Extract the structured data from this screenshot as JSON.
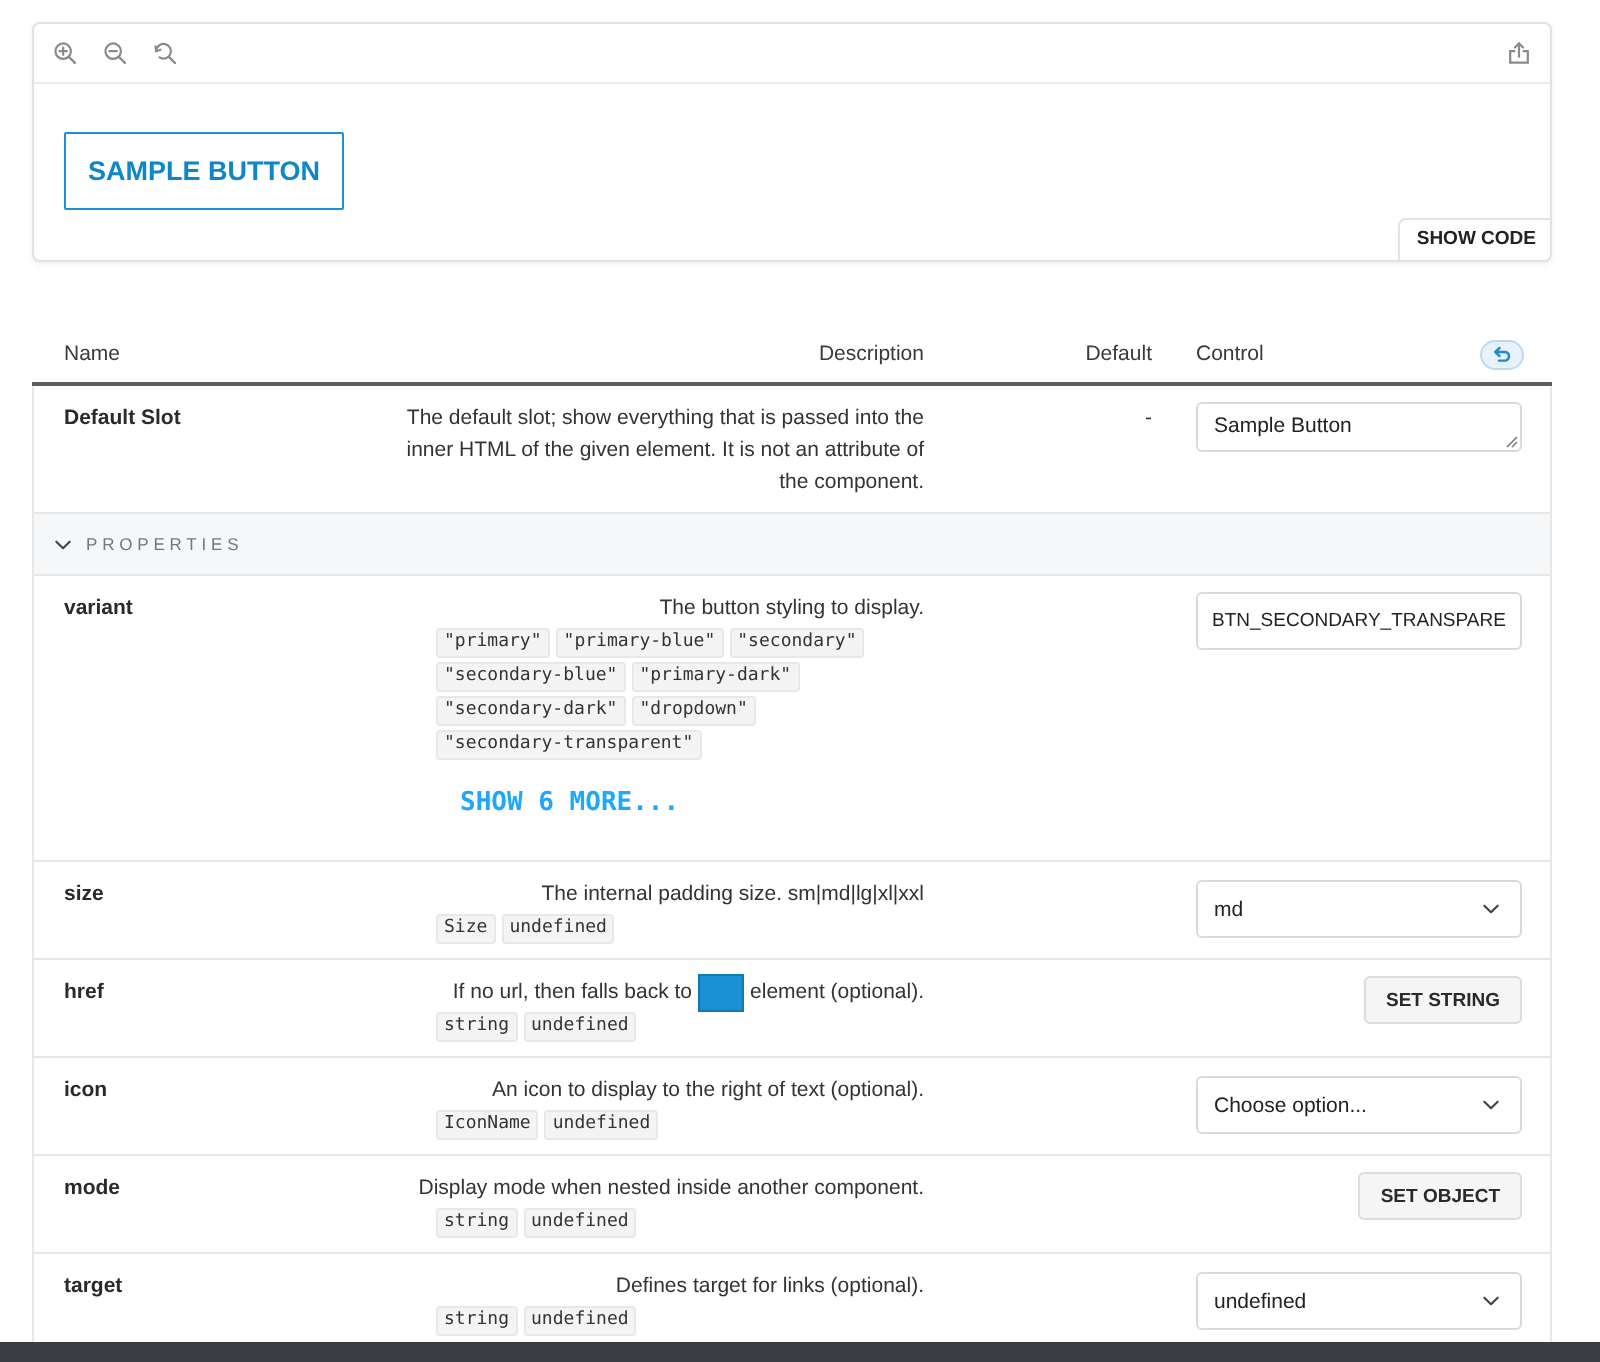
{
  "preview": {
    "sample_button": "SAMPLE BUTTON",
    "show_code": "SHOW CODE"
  },
  "table": {
    "columns": [
      "Name",
      "Description",
      "Default",
      "Control"
    ],
    "rows": [
      {
        "name": "Default Slot",
        "description": "The default slot; show everything that is passed into the inner HTML of the given element. It is not an attribute of the component.",
        "default": "-",
        "control": {
          "kind": "textarea",
          "value": "Sample Button"
        }
      }
    ],
    "sections": [
      {
        "title": "PROPERTIES",
        "expanded": true,
        "rows": [
          {
            "name": "variant",
            "description": "The button styling to display.",
            "types": [
              "\"primary\"",
              "\"primary-blue\"",
              "\"secondary\"",
              "\"secondary-blue\"",
              "\"primary-dark\"",
              "\"secondary-dark\"",
              "\"dropdown\"",
              "\"secondary-transparent\""
            ],
            "show_more": "SHOW 6 MORE...",
            "control": {
              "kind": "input",
              "value": "BTN_SECONDARY_TRANSPARE"
            }
          },
          {
            "name": "size",
            "description": "The internal padding size. sm|md|lg|xl|xxl",
            "types": [
              "Size",
              "undefined"
            ],
            "control": {
              "kind": "select",
              "value": "md"
            }
          },
          {
            "name": "href",
            "description": [
              {
                "kind": "text",
                "text": "If no url, then falls back to"
              },
              {
                "kind": "block"
              },
              {
                "kind": "text",
                "text": "element (optional)."
              }
            ],
            "types": [
              "string",
              "undefined"
            ],
            "control": {
              "kind": "button",
              "label": "SET STRING"
            }
          },
          {
            "name": "icon",
            "description": "An icon to display to the right of text (optional).",
            "types": [
              "IconName",
              "undefined"
            ],
            "control": {
              "kind": "select",
              "value": "Choose option..."
            }
          },
          {
            "name": "mode",
            "description": "Display mode when nested inside another component.",
            "types": [
              "string",
              "undefined"
            ],
            "control": {
              "kind": "button",
              "label": "SET OBJECT"
            }
          },
          {
            "name": "target",
            "description": "Defines target for links (optional).",
            "types": [
              "string",
              "undefined"
            ],
            "control": {
              "kind": "select",
              "value": "undefined"
            }
          }
        ]
      }
    ]
  }
}
